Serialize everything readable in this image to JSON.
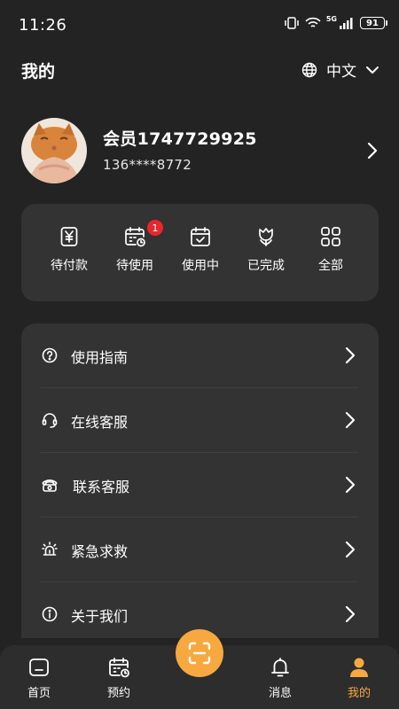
{
  "status_bar": {
    "time": "11:26",
    "network": "5G",
    "battery": "91"
  },
  "header": {
    "title": "我的",
    "language": "中文"
  },
  "profile": {
    "username": "会员1747729925",
    "phone": "136****8772"
  },
  "orders": [
    {
      "label": "待付款",
      "icon": "payment-icon",
      "badge": ""
    },
    {
      "label": "待使用",
      "icon": "calendar-clock-icon",
      "badge": "1"
    },
    {
      "label": "使用中",
      "icon": "calendar-check-icon",
      "badge": ""
    },
    {
      "label": "已完成",
      "icon": "tulip-icon",
      "badge": ""
    },
    {
      "label": "全部",
      "icon": "grid-icon",
      "badge": ""
    }
  ],
  "menu": [
    {
      "label": "使用指南",
      "icon": "help-icon"
    },
    {
      "label": "在线客服",
      "icon": "headset-icon"
    },
    {
      "label": "联系客服",
      "icon": "telephone-icon"
    },
    {
      "label": "紧急求救",
      "icon": "alarm-icon"
    },
    {
      "label": "关于我们",
      "icon": "info-icon"
    }
  ],
  "nav": {
    "home": "首页",
    "booking": "预约",
    "messages": "消息",
    "mine": "我的",
    "active_color": "#f7a940"
  }
}
